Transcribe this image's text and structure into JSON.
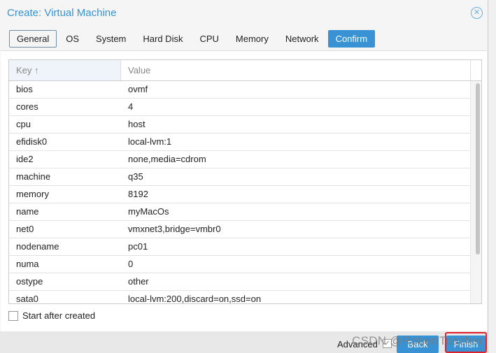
{
  "dialog": {
    "title": "Create: Virtual Machine",
    "close_icon": "close-circle-icon"
  },
  "tabs": [
    {
      "label": "General"
    },
    {
      "label": "OS"
    },
    {
      "label": "System"
    },
    {
      "label": "Hard Disk"
    },
    {
      "label": "CPU"
    },
    {
      "label": "Memory"
    },
    {
      "label": "Network"
    },
    {
      "label": "Confirm"
    }
  ],
  "grid": {
    "headers": {
      "key": "Key ↑",
      "value": "Value"
    },
    "rows": [
      {
        "key": "bios",
        "value": "ovmf"
      },
      {
        "key": "cores",
        "value": "4"
      },
      {
        "key": "cpu",
        "value": "host"
      },
      {
        "key": "efidisk0",
        "value": "local-lvm:1"
      },
      {
        "key": "ide2",
        "value": "none,media=cdrom"
      },
      {
        "key": "machine",
        "value": "q35"
      },
      {
        "key": "memory",
        "value": "8192"
      },
      {
        "key": "name",
        "value": "myMacOs"
      },
      {
        "key": "net0",
        "value": "vmxnet3,bridge=vmbr0"
      },
      {
        "key": "nodename",
        "value": "pc01"
      },
      {
        "key": "numa",
        "value": "0"
      },
      {
        "key": "ostype",
        "value": "other"
      },
      {
        "key": "sata0",
        "value": "local-lvm:200,discard=on,ssd=on"
      }
    ]
  },
  "start_after_created": {
    "label": "Start after created",
    "checked": false
  },
  "footer": {
    "advanced_label": "Advanced",
    "advanced_checked": true,
    "back": "Back",
    "finish": "Finish"
  },
  "watermark": "CSDN @RobertTeacher",
  "colors": {
    "accent": "#3892d4",
    "highlight": "#e0202a"
  }
}
